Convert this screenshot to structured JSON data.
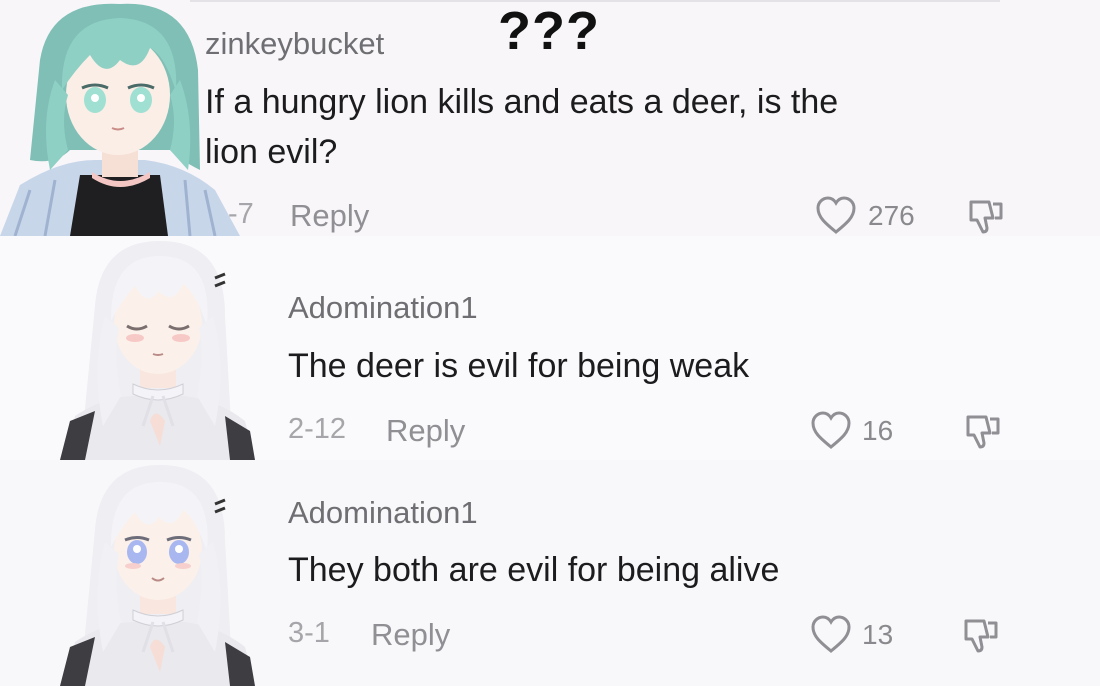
{
  "overlay_text": "???",
  "comments": [
    {
      "username": "zinkeybucket",
      "text_line1": "If a hungry lion kills and eats a deer, is the",
      "text_line2": "lion evil?",
      "date": "-7",
      "reply_label": "Reply",
      "likes": "276"
    },
    {
      "username": "Adomination1",
      "text_line1": "The deer is evil for being weak",
      "date": "2-12",
      "reply_label": "Reply",
      "likes": "16"
    },
    {
      "username": "Adomination1",
      "text_line1": "They both are evil for being alive",
      "date": "3-1",
      "reply_label": "Reply",
      "likes": "13"
    }
  ],
  "icons": {
    "like": "heart-outline-icon",
    "dislike": "thumbs-down-outline-icon"
  },
  "colors": {
    "teal_hair": "#8fc9c0",
    "white_hair": "#f2f2f6",
    "text_dark": "#1c1c1e",
    "text_gray": "#8f8f94"
  }
}
